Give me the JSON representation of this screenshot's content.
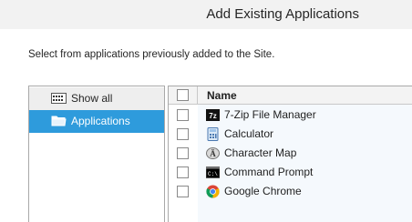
{
  "window": {
    "title": "Add Existing Applications"
  },
  "instructions": "Select from applications previously added to the Site.",
  "categories": [
    {
      "label": "Show all",
      "icon": "list-icon",
      "selected": false
    },
    {
      "label": "Applications",
      "icon": "folder-icon",
      "selected": true
    }
  ],
  "grid": {
    "column_header": "Name",
    "rows": [
      {
        "name": "7-Zip File Manager",
        "icon": "7zip-icon",
        "checked": false
      },
      {
        "name": "Calculator",
        "icon": "calculator-icon",
        "checked": false
      },
      {
        "name": "Character Map",
        "icon": "character-map-icon",
        "checked": false
      },
      {
        "name": "Command Prompt",
        "icon": "command-prompt-icon",
        "checked": false
      },
      {
        "name": "Google Chrome",
        "icon": "chrome-icon",
        "checked": false
      }
    ]
  },
  "colors": {
    "selected_category_bg": "#2e9bdc",
    "grid_bg": "#f5f9fd"
  }
}
